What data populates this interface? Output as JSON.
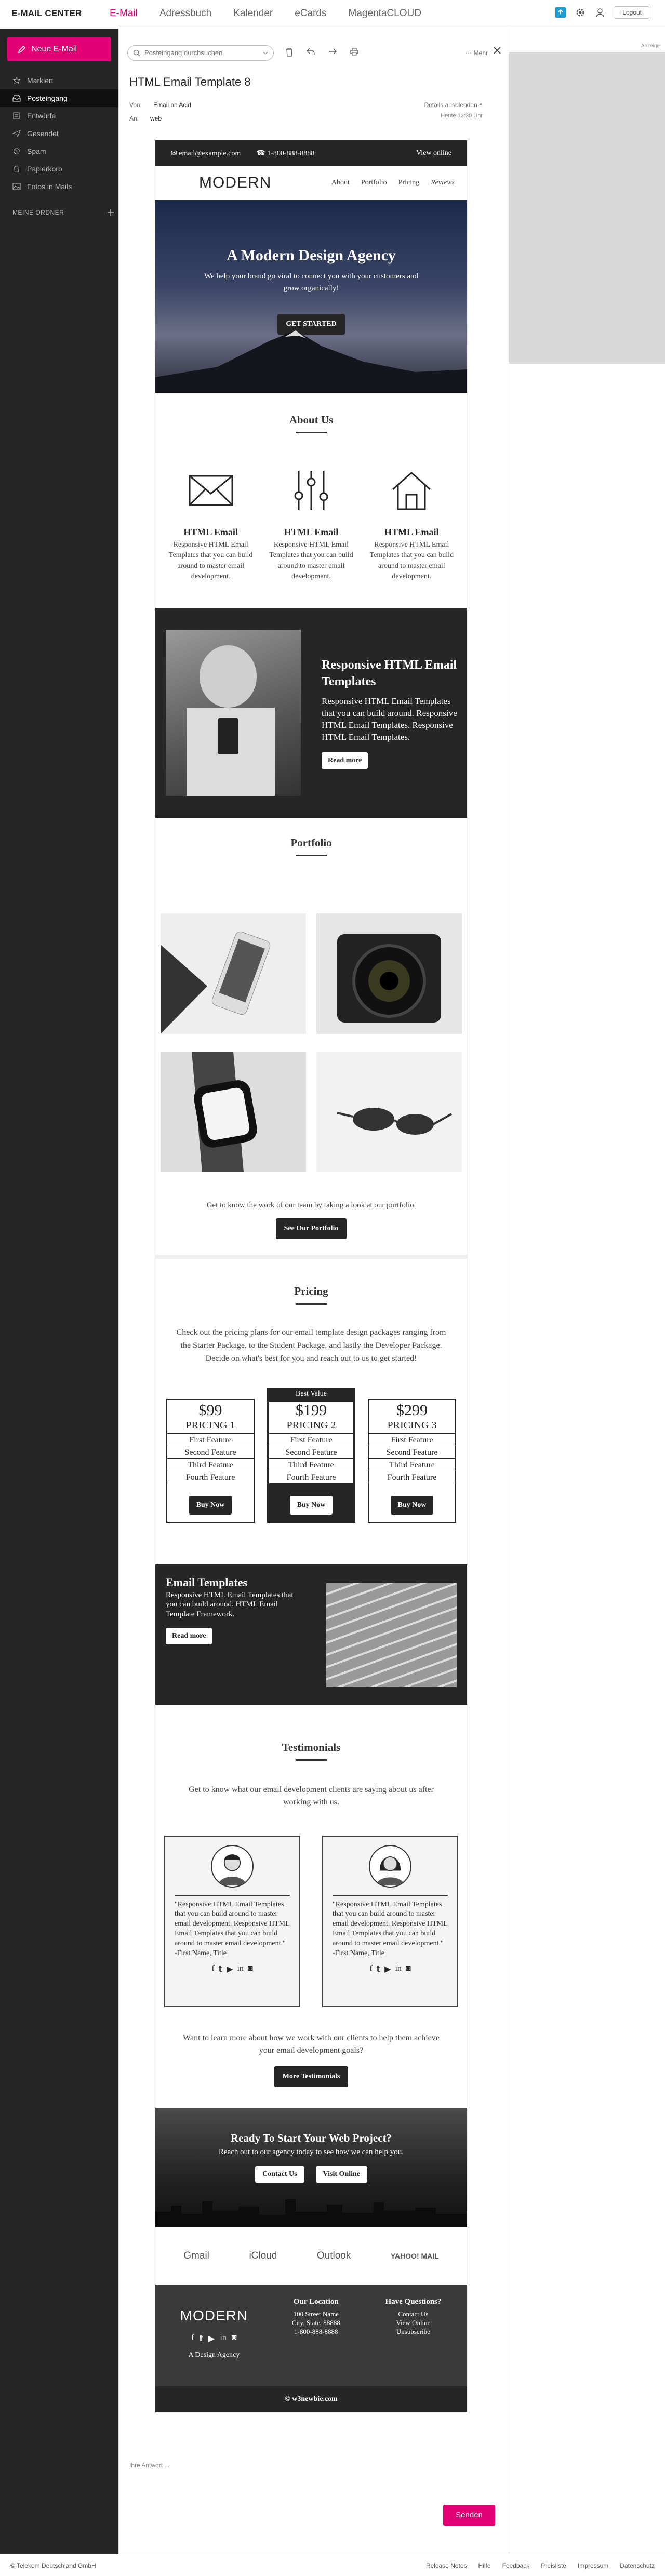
{
  "app": {
    "brand": "E-MAIL CENTER",
    "nav": [
      "E-Mail",
      "Adressbuch",
      "Kalender",
      "eCards",
      "MagentaCLOUD"
    ],
    "logout": "Logout"
  },
  "sidebar": {
    "new_mail": "Neue E-Mail",
    "folders": [
      {
        "label": "Markiert",
        "icon": "star-icon"
      },
      {
        "label": "Posteingang",
        "icon": "inbox-icon"
      },
      {
        "label": "Entwürfe",
        "icon": "draft-icon"
      },
      {
        "label": "Gesendet",
        "icon": "send-icon"
      },
      {
        "label": "Spam",
        "icon": "spam-icon"
      },
      {
        "label": "Papierkorb",
        "icon": "trash-icon"
      },
      {
        "label": "Fotos in Mails",
        "icon": "photo-icon"
      }
    ],
    "my_folders": "MEINE ORDNER"
  },
  "toolbar": {
    "search_placeholder": "Posteingang durchsuchen",
    "more": "Mehr"
  },
  "message": {
    "subject": "HTML Email Template 8",
    "from_label": "Von:",
    "from": "Email on Acid",
    "to_label": "An:",
    "to": "web",
    "details": "Details ausblenden",
    "date": "Heute 13:30 Uhr"
  },
  "email": {
    "topbar": {
      "email": "email@example.com",
      "phone": "1-800-888-8888",
      "view_online": "View online"
    },
    "logo": "MODERN",
    "links": [
      "About",
      "Portfolio",
      "Pricing",
      "Reviews"
    ],
    "hero": {
      "title": "A Modern Design Agency",
      "text": "We help your brand go viral to connect you with your customers and grow organically!",
      "button": "GET STARTED"
    },
    "about": {
      "title": "About Us",
      "features": [
        {
          "title": "HTML Email",
          "text": "Responsive HTML Email Templates that you can build around to master email development.",
          "icon": "envelope-icon"
        },
        {
          "title": "HTML Email",
          "text": "Responsive HTML Email Templates that you can build around to master email development.",
          "icon": "sliders-icon"
        },
        {
          "title": "HTML Email",
          "text": "Responsive HTML Email Templates that you can build around to master email development.",
          "icon": "house-icon"
        }
      ]
    },
    "responsive": {
      "title": "Responsive HTML Email Templates",
      "text": "Responsive HTML Email Templates that you can build around. Responsive HTML Email Templates. Responsive HTML Email Templates.",
      "button": "Read more"
    },
    "portfolio": {
      "title": "Portfolio",
      "caption": "Get to know the work of our team by taking a look at our portfolio.",
      "button": "See Our Portfolio"
    },
    "pricing": {
      "title": "Pricing",
      "intro": "Check out the pricing plans for our email template design packages ranging from the Starter Package, to the Student Package, and lastly the Developer Package. Decide on what's best for you and reach out to us to get started!",
      "best_value": "Best Value",
      "plans": [
        {
          "price": "$99",
          "name": "PRICING 1",
          "features": [
            "First Feature",
            "Second Feature",
            "Third Feature",
            "Fourth Feature"
          ],
          "button": "Buy Now"
        },
        {
          "price": "$199",
          "name": "PRICING 2",
          "features": [
            "First Feature",
            "Second Feature",
            "Third Feature",
            "Fourth Feature"
          ],
          "button": "Buy Now"
        },
        {
          "price": "$299",
          "name": "PRICING 3",
          "features": [
            "First Feature",
            "Second Feature",
            "Third Feature",
            "Fourth Feature"
          ],
          "button": "Buy Now"
        }
      ]
    },
    "templates": {
      "title": "Email Templates",
      "text": "Responsive HTML Email Templates that you can build around. HTML Email Template Framework.",
      "button": "Read more"
    },
    "testimonials": {
      "title": "Testimonials",
      "intro": "Get to know what our email development clients are saying about us after working with us.",
      "cards": [
        {
          "quote": "\"Responsive HTML Email Templates that you can build around to master email development. Responsive HTML Email Templates that you can build around to master email development.\"",
          "author": "-First Name, Title"
        },
        {
          "quote": "\"Responsive HTML Email Templates that you can build around to master email development. Responsive HTML Email Templates that you can build around to master email development.\"",
          "author": "-First Name, Title"
        }
      ],
      "outro": "Want to learn more about how we work with our clients to help them achieve your email development goals?",
      "button": "More Testimonials"
    },
    "cta": {
      "title": "Ready To Start Your Web Project?",
      "text": "Reach out to our agency today to see how we can help you.",
      "contact": "Contact Us",
      "visit": "Visit Online"
    },
    "brands": [
      "Gmail",
      "iCloud",
      "Outlook",
      "YAHOO! MAIL"
    ],
    "footer": {
      "logo": "MODERN",
      "tagline": "A Design Agency",
      "location_title": "Our Location",
      "location": [
        "100 Street Name",
        "City, State, 88888",
        "1-800-888-8888"
      ],
      "questions_title": "Have Questions?",
      "questions": [
        "Contact Us",
        "View Online",
        "Unsubscribe"
      ],
      "copyright": "© w3newbie.com"
    }
  },
  "compose_hint": "Ihre Antwort ...",
  "send": "Senden",
  "ad_label": "Anzeige",
  "bottom": {
    "company": "© Telekom Deutschland GmbH",
    "links": [
      "Release Notes",
      "Hilfe",
      "Feedback",
      "Preisliste",
      "Impressum",
      "Datenschutz"
    ]
  }
}
